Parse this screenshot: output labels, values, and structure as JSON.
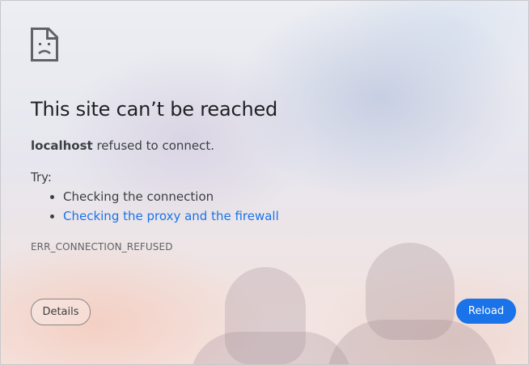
{
  "error_page": {
    "icon": "sad-page-icon",
    "title": "This site can’t be reached",
    "summary": {
      "host": "localhost",
      "message": "refused to connect."
    },
    "try_label": "Try:",
    "suggestions": [
      {
        "label": "Checking the connection",
        "is_link": false
      },
      {
        "label": "Checking the proxy and the firewall",
        "is_link": true
      }
    ],
    "error_code": "ERR_CONNECTION_REFUSED"
  },
  "buttons": {
    "details_label": "Details",
    "reload_label": "Reload"
  },
  "colors": {
    "accent": "#1a73e8",
    "link": "#1a73e8",
    "text": "#3c4043",
    "title": "#202124"
  }
}
